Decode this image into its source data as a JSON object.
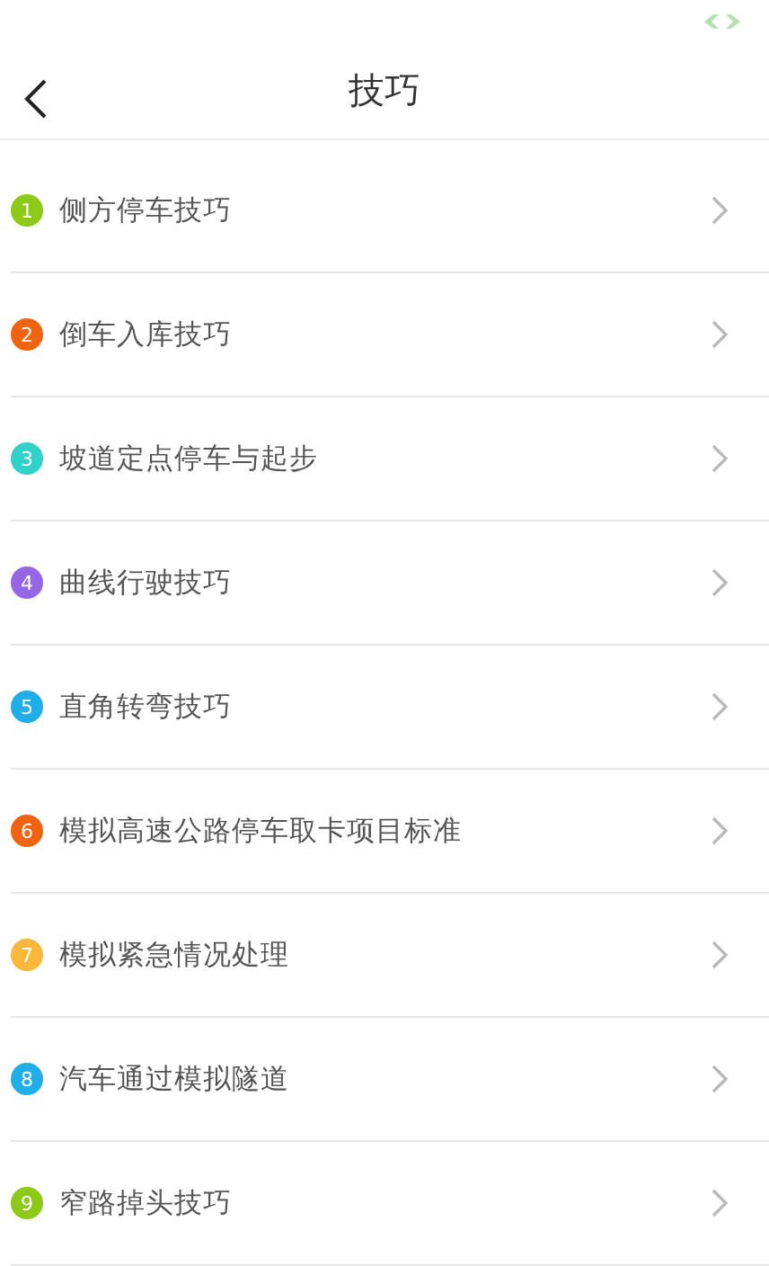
{
  "header": {
    "title": "技巧"
  },
  "items": [
    {
      "number": "1",
      "label": "侧方停车技巧",
      "color": "#8cc919"
    },
    {
      "number": "2",
      "label": "倒车入库技巧",
      "color": "#f0640f"
    },
    {
      "number": "3",
      "label": "坡道定点停车与起步",
      "color": "#2fd1c8"
    },
    {
      "number": "4",
      "label": "曲线行驶技巧",
      "color": "#9566e6"
    },
    {
      "number": "5",
      "label": "直角转弯技巧",
      "color": "#20aee8"
    },
    {
      "number": "6",
      "label": "模拟高速公路停车取卡项目标准",
      "color": "#f0640f"
    },
    {
      "number": "7",
      "label": "模拟紧急情况处理",
      "color": "#fbb73a"
    },
    {
      "number": "8",
      "label": "汽车通过模拟隧道",
      "color": "#20aee8"
    },
    {
      "number": "9",
      "label": "窄路掉头技巧",
      "color": "#8cc919"
    }
  ]
}
